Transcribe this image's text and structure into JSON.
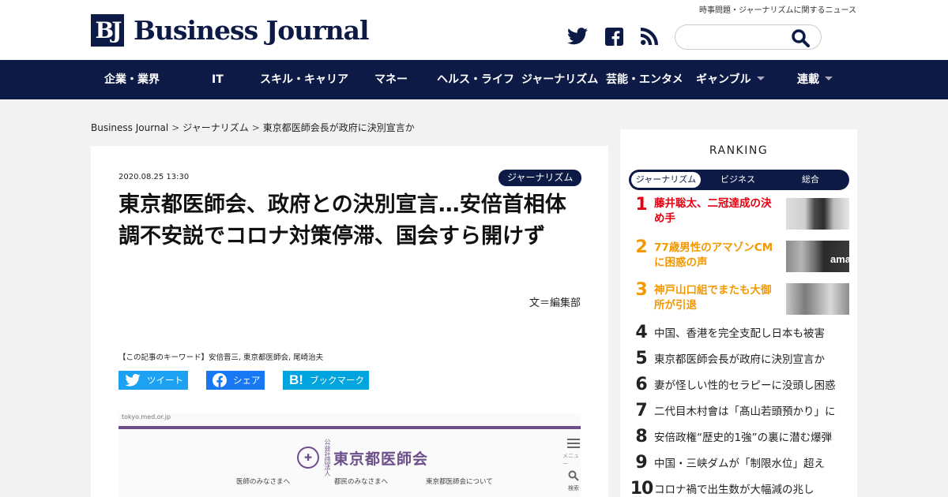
{
  "header": {
    "logo_mark": "BJ",
    "logo_text": "Business Journal",
    "tagline": "時事問題・ジャーナリズムに関するニュース",
    "social": [
      "twitter-icon",
      "facebook-icon",
      "rss-icon"
    ],
    "search_value": ""
  },
  "nav": {
    "items": [
      {
        "label": "企業・業界"
      },
      {
        "label": "IT"
      },
      {
        "label": "スキル・キャリア"
      },
      {
        "label": "マネー"
      },
      {
        "label": "ヘルス・ライフ"
      },
      {
        "label": "ジャーナリズム"
      },
      {
        "label": "芸能・エンタメ"
      },
      {
        "label": "ギャンブル"
      },
      {
        "label": "連載"
      }
    ]
  },
  "breadcrumb": {
    "items": [
      "Business Journal",
      "ジャーナリズム",
      "東京都医師会長が政府に決別宣言か"
    ],
    "separator": ">"
  },
  "article": {
    "date": "2020.08.25 13:30",
    "category": "ジャーナリズム",
    "title": "東京都医師会、政府との決別宣言…安倍首相体調不安説でコロナ対策停滞、国会すら開けず",
    "byline": "文＝編集部",
    "keywords": "【この記事のキーワード】安倍晋三, 東京都医師会, 尾崎治夫",
    "share": [
      {
        "label": "ツイート",
        "color": "#1da1f2",
        "icon": "twitter-icon"
      },
      {
        "label": "シェア",
        "color": "#1877f2",
        "icon": "facebook-icon"
      },
      {
        "label": "ブックマーク",
        "color": "#00a4de",
        "icon": "hatena-icon"
      }
    ],
    "hero": {
      "url": "tokyo.med.or.jp",
      "org_small": "公益社団法人",
      "org_name": "東京都医師会",
      "links": [
        "医師のみなさまへ",
        "都民のみなさまへ",
        "東京都医師会について"
      ],
      "menu_label": "メニュー",
      "search_label": "検索"
    }
  },
  "ranking": {
    "title": "RANKING",
    "tabs": [
      "ジャーナリズム",
      "ビジネス",
      "総合"
    ],
    "active_tab": 0,
    "items": [
      {
        "rank": "1",
        "text": "藤井聡太、二冠達成の決め手",
        "color": "#e60012"
      },
      {
        "rank": "2",
        "text": "77歳男性のアマゾンCMに困惑の声",
        "color": "#f39800"
      },
      {
        "rank": "3",
        "text": "神戸山口組でまたも大御所が引退",
        "color": "#f39800"
      },
      {
        "rank": "4",
        "text": "中国、香港を完全支配し日本も被害",
        "color": "#222222"
      },
      {
        "rank": "5",
        "text": "東京都医師会長が政府に決別宣言か",
        "color": "#222222"
      },
      {
        "rank": "6",
        "text": "妻が怪しい性的セラピーに没頭し困惑",
        "color": "#222222"
      },
      {
        "rank": "7",
        "text": "二代目木村會は「髙山若頭預かり」に",
        "color": "#222222"
      },
      {
        "rank": "8",
        "text": "安倍政権“歴史的1強”の裏に潜む爆弾",
        "color": "#222222"
      },
      {
        "rank": "9",
        "text": "中国・三峡ダムが「制限水位」超え",
        "color": "#222222"
      },
      {
        "rank": "10",
        "text": "コロナ禍で出生数が大幅減の兆し",
        "color": "#222222"
      }
    ]
  },
  "colors": {
    "brand_navy": "#0d1a45",
    "accent_purple": "#6c4f8a"
  }
}
